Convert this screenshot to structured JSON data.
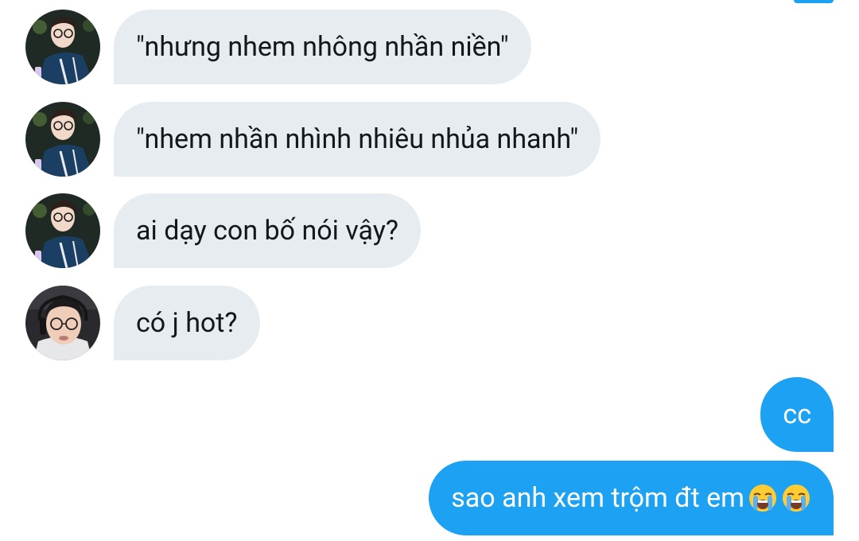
{
  "colors": {
    "incoming_bubble": "#e6ecf0",
    "outgoing_bubble": "#1da1f2",
    "incoming_text": "#14171a",
    "outgoing_text": "#ffffff"
  },
  "messages": [
    {
      "direction": "incoming",
      "avatar": "user-1-avatar",
      "text": "\"nhưng nhem nhông nhần niền\""
    },
    {
      "direction": "incoming",
      "avatar": "user-1-avatar",
      "text": "\"nhem nhần nhình nhiêu nhủa nhanh\""
    },
    {
      "direction": "incoming",
      "avatar": "user-1-avatar",
      "text": "ai dạy con bố nói vậy?"
    },
    {
      "direction": "incoming",
      "avatar": "user-2-avatar",
      "text": "có j hot?"
    },
    {
      "direction": "outgoing",
      "text": "cc"
    },
    {
      "direction": "outgoing",
      "text": "sao anh xem trộm đt em",
      "emojis": [
        "loudly-crying-face-icon",
        "loudly-crying-face-icon"
      ]
    }
  ]
}
